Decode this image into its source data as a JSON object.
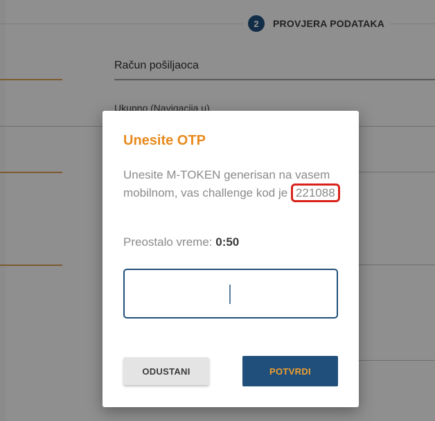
{
  "stepper": {
    "step_number": "2",
    "step_label": "PROVJERA PODATAKA"
  },
  "form": {
    "sender_account_label": "Račun pošiljaoca",
    "partial_field_label": "Ukupno (Navigacija u)"
  },
  "dialog": {
    "title": "Unesite OTP",
    "message_prefix": "Unesite M-TOKEN generisan na vasem mobilnom, vas challenge kod je",
    "challenge_code": "221088",
    "remaining_label": "Preostalo vreme:",
    "remaining_value": "0:50",
    "otp_value": "",
    "cancel_label": "ODUSTANI",
    "confirm_label": "POTVRDI"
  },
  "colors": {
    "primary": "#1f4f7a",
    "accent": "#e88a1d",
    "highlight": "#d8221a"
  }
}
